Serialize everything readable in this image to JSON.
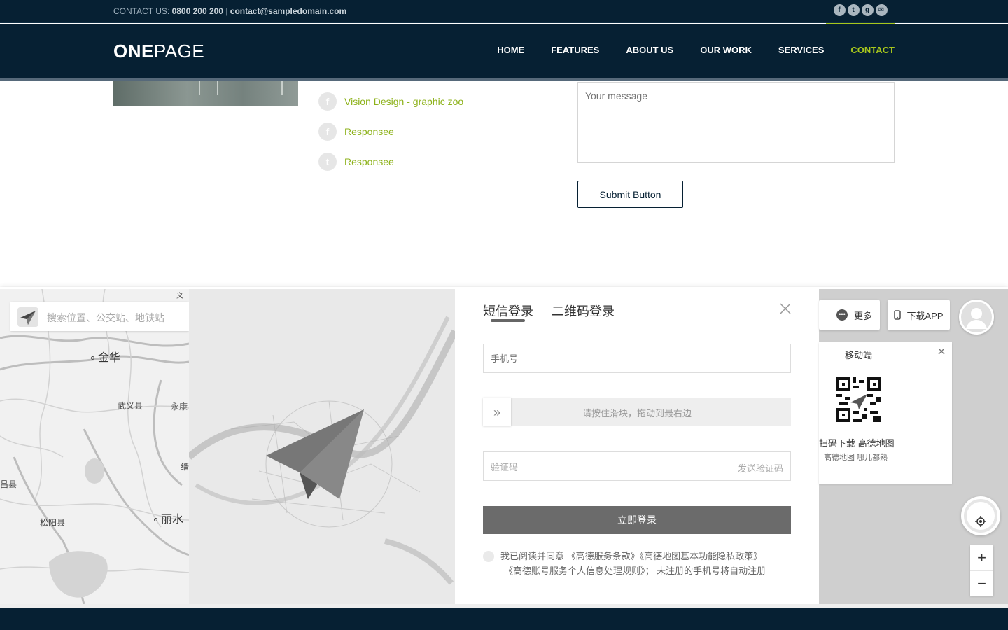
{
  "topbar": {
    "contact_label": "CONTACT US:",
    "phone": "0800 200 200",
    "separator": "|",
    "email": "contact@sampledomain.com",
    "social_icons": [
      "facebook-icon",
      "twitter-icon",
      "google-plus-icon",
      "email-icon"
    ]
  },
  "nav": {
    "logo_bold": "ONE",
    "logo_light": "PAGE",
    "items": [
      {
        "label": "HOME"
      },
      {
        "label": "FEATURES"
      },
      {
        "label": "ABOUT US"
      },
      {
        "label": "OUR WORK"
      },
      {
        "label": "SERVICES"
      },
      {
        "label": "CONTACT",
        "active": true
      }
    ],
    "accent_color": "#a8c71c"
  },
  "links": [
    {
      "icon": "facebook-icon",
      "glyph": "f",
      "label": "Vision Design - graphic zoo"
    },
    {
      "icon": "facebook-icon",
      "glyph": "f",
      "label": "Responsee"
    },
    {
      "icon": "twitter-icon",
      "glyph": "t",
      "label": "Responsee"
    }
  ],
  "form": {
    "message_placeholder": "Your message",
    "submit_label": "Submit Button"
  },
  "map": {
    "search_placeholder": "搜索位置、公交站、地铁站",
    "labels": {
      "jinhua": "金华",
      "wuyi": "武义县",
      "yongkang": "永康",
      "jin": "缙",
      "lishui": "丽水",
      "songyang": "松阳县",
      "changshan": "昌县",
      "top": "义"
    },
    "more_label": "更多",
    "download_app_label": "下载APP",
    "qr": {
      "title": "移动端",
      "desc1": "扫码下载 高德地图",
      "desc2": "高德地图 哪儿都熟"
    },
    "zoom_in": "+",
    "zoom_out": "−"
  },
  "login": {
    "tab_sms": "短信登录",
    "tab_qr": "二维码登录",
    "phone_placeholder": "手机号",
    "slider_knob": "»",
    "slider_text": "请按住滑块，拖动到最右边",
    "code_placeholder": "验证码",
    "send_code": "发送验证码",
    "submit": "立即登录",
    "agree_line1": "我已阅读并同意 《高德服务条款》《高德地图基本功能隐私政策》",
    "agree_line2": "《高德账号服务个人信息处理规则》； 未注册的手机号将自动注册"
  }
}
